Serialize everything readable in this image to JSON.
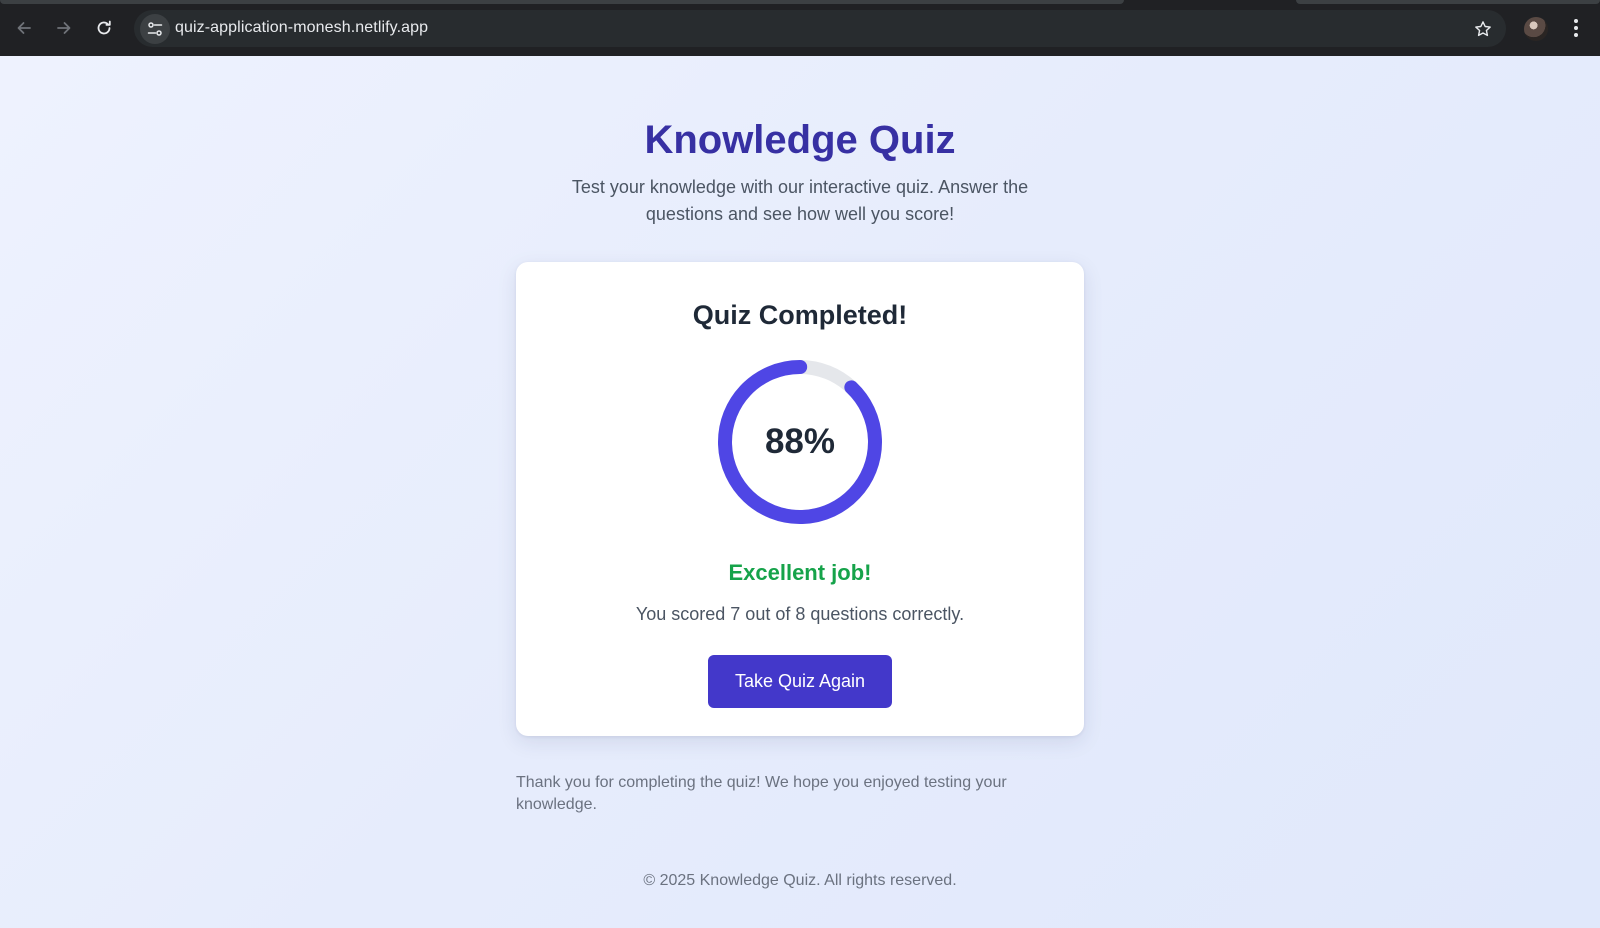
{
  "browser": {
    "url": "quiz-application-monesh.netlify.app",
    "back_icon": "arrow-left-icon",
    "forward_icon": "arrow-right-icon",
    "reload_icon": "reload-icon",
    "site_info_icon": "tune-icon",
    "bookmark_icon": "star-icon",
    "menu_icon": "more-vert-icon"
  },
  "header": {
    "title": "Knowledge Quiz",
    "subtitle": "Test your knowledge with our interactive quiz. Answer the questions and see how well you score!"
  },
  "result": {
    "heading": "Quiz Completed!",
    "percent_label": "88%",
    "percent_value": 0.88,
    "feedback": "Excellent job!",
    "score_text": "You scored 7 out of 8 questions correctly.",
    "retry_label": "Take Quiz Again"
  },
  "thanks_text": "Thank you for completing the quiz! We hope you enjoyed testing your knowledge.",
  "footer": "© 2025 Knowledge Quiz. All rights reserved.",
  "colors": {
    "accent": "#4338ca",
    "ring_progress": "#4f46e5",
    "ring_track": "#e5e7eb",
    "title": "#3730a3",
    "success": "#16a34a"
  }
}
